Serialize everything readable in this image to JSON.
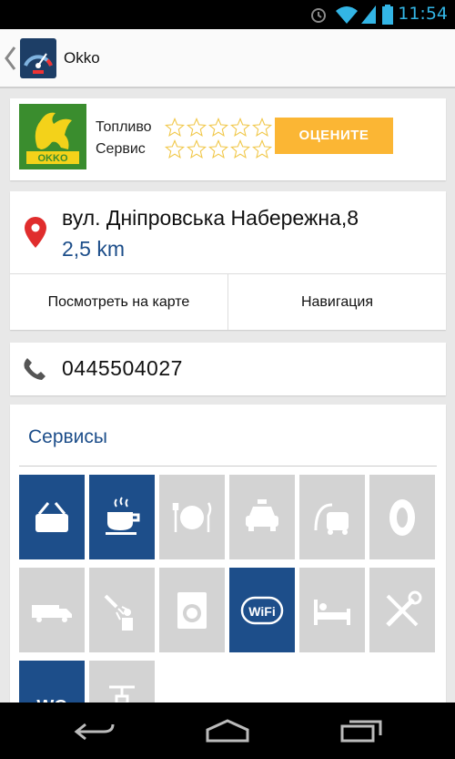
{
  "status_bar": {
    "time": "11:54"
  },
  "app_bar": {
    "title": "Okko",
    "icon": "fuel-gauge-icon"
  },
  "rating": {
    "logo_text": "OKKO",
    "fuel_label": "Топливо",
    "service_label": "Сервис",
    "fuel_stars": 0,
    "service_stars": 0,
    "rate_button": "ОЦЕНИТЕ"
  },
  "location": {
    "address": "вул. Дніпровська Набережна,8",
    "distance": "2,5 km",
    "map_button": "Посмотреть на карте",
    "navigation_button": "Навигация"
  },
  "contact": {
    "phone": "0445504027"
  },
  "services": {
    "title": "Сервисы",
    "items": [
      {
        "name": "shop-basket-icon",
        "active": true
      },
      {
        "name": "coffee-cup-icon",
        "active": true
      },
      {
        "name": "restaurant-icon",
        "active": false
      },
      {
        "name": "taxi-icon",
        "active": false
      },
      {
        "name": "vacuum-cleaner-icon",
        "active": false
      },
      {
        "name": "tire-icon",
        "active": false
      },
      {
        "name": "truck-icon",
        "active": false
      },
      {
        "name": "shower-icon",
        "active": false
      },
      {
        "name": "washing-machine-icon",
        "active": false
      },
      {
        "name": "wifi-icon",
        "active": true,
        "label": "Wi Fi"
      },
      {
        "name": "hotel-bed-icon",
        "active": false
      },
      {
        "name": "repair-tools-icon",
        "active": false
      },
      {
        "name": "wc-icon",
        "active": true,
        "label": "WC"
      },
      {
        "name": "air-pump-icon",
        "active": false
      }
    ]
  },
  "colors": {
    "accent": "#1d4e8a",
    "rate_button": "#fbb634",
    "logo_green": "#3a8d2e",
    "inactive_tile": "#d3d3d3",
    "star": "#f1c84b"
  }
}
